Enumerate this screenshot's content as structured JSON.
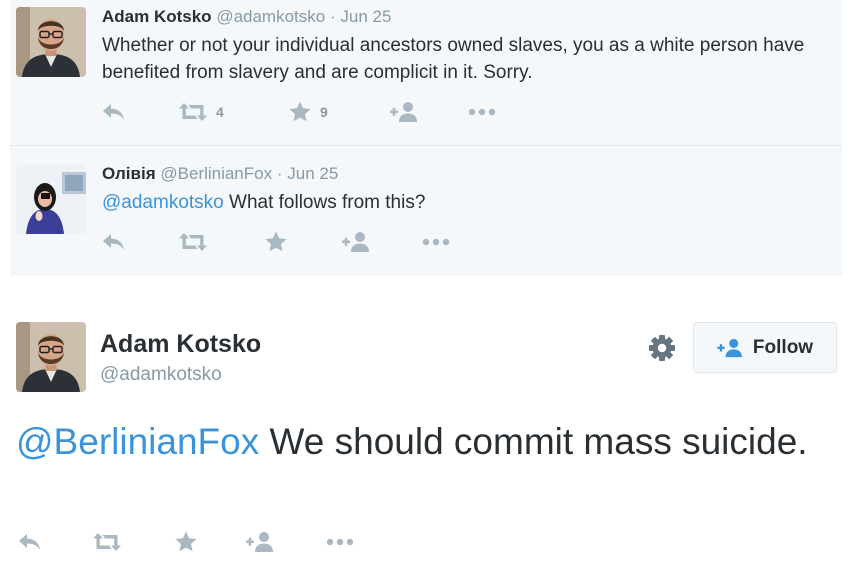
{
  "thread": {
    "tweets": [
      {
        "name": "Adam Kotsko",
        "handle": "@adamkotsko",
        "separator": "·",
        "date": "Jun 25",
        "mention": "",
        "text": "Whether or not your individual ancestors owned slaves, you as a white person have benefited from slavery and are complicit in it. Sorry.",
        "retweets": "4",
        "favorites": "9"
      },
      {
        "name": "Олівія",
        "handle": "@BerlinianFox",
        "separator": "·",
        "date": "Jun 25",
        "mention": "@adamkotsko",
        "text": " What follows from this?",
        "retweets": "",
        "favorites": ""
      }
    ]
  },
  "main_tweet": {
    "name": "Adam Kotsko",
    "handle": "@adamkotsko",
    "follow_label": "Follow",
    "mention": "@BerlinianFox",
    "text": " We should commit mass suicide."
  },
  "icons": {
    "reply": "reply-icon",
    "retweet": "retweet-icon",
    "favorite": "star-icon",
    "follow": "add-user-icon",
    "more": "more-dots-icon",
    "settings": "gear-icon"
  },
  "colors": {
    "link": "#3b94d9",
    "action_icon": "#aab8c2",
    "muted_text": "#8899a6",
    "thread_background": "#f5f8fa"
  }
}
